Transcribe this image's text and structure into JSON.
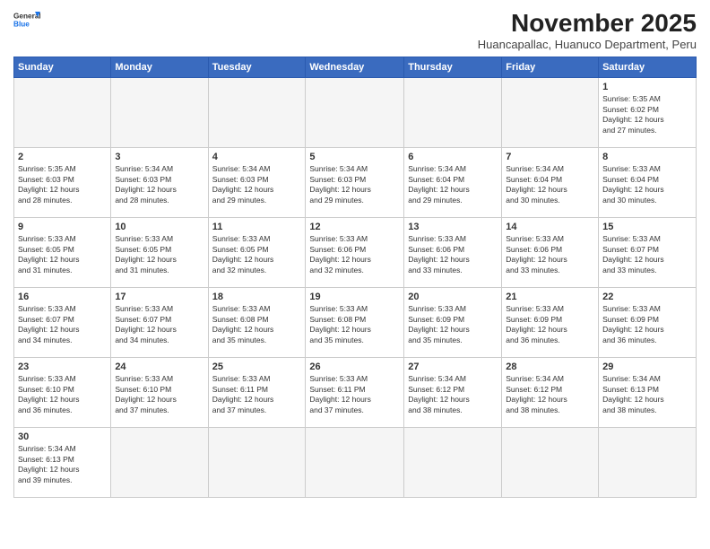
{
  "logo": {
    "text_general": "General",
    "text_blue": "Blue"
  },
  "header": {
    "month": "November 2025",
    "location": "Huancapallac, Huanuco Department, Peru"
  },
  "weekdays": [
    "Sunday",
    "Monday",
    "Tuesday",
    "Wednesday",
    "Thursday",
    "Friday",
    "Saturday"
  ],
  "weeks": [
    [
      {
        "day": "",
        "info": ""
      },
      {
        "day": "",
        "info": ""
      },
      {
        "day": "",
        "info": ""
      },
      {
        "day": "",
        "info": ""
      },
      {
        "day": "",
        "info": ""
      },
      {
        "day": "",
        "info": ""
      },
      {
        "day": "1",
        "info": "Sunrise: 5:35 AM\nSunset: 6:02 PM\nDaylight: 12 hours\nand 27 minutes."
      }
    ],
    [
      {
        "day": "2",
        "info": "Sunrise: 5:35 AM\nSunset: 6:03 PM\nDaylight: 12 hours\nand 28 minutes."
      },
      {
        "day": "3",
        "info": "Sunrise: 5:34 AM\nSunset: 6:03 PM\nDaylight: 12 hours\nand 28 minutes."
      },
      {
        "day": "4",
        "info": "Sunrise: 5:34 AM\nSunset: 6:03 PM\nDaylight: 12 hours\nand 29 minutes."
      },
      {
        "day": "5",
        "info": "Sunrise: 5:34 AM\nSunset: 6:03 PM\nDaylight: 12 hours\nand 29 minutes."
      },
      {
        "day": "6",
        "info": "Sunrise: 5:34 AM\nSunset: 6:04 PM\nDaylight: 12 hours\nand 29 minutes."
      },
      {
        "day": "7",
        "info": "Sunrise: 5:34 AM\nSunset: 6:04 PM\nDaylight: 12 hours\nand 30 minutes."
      },
      {
        "day": "8",
        "info": "Sunrise: 5:33 AM\nSunset: 6:04 PM\nDaylight: 12 hours\nand 30 minutes."
      }
    ],
    [
      {
        "day": "9",
        "info": "Sunrise: 5:33 AM\nSunset: 6:05 PM\nDaylight: 12 hours\nand 31 minutes."
      },
      {
        "day": "10",
        "info": "Sunrise: 5:33 AM\nSunset: 6:05 PM\nDaylight: 12 hours\nand 31 minutes."
      },
      {
        "day": "11",
        "info": "Sunrise: 5:33 AM\nSunset: 6:05 PM\nDaylight: 12 hours\nand 32 minutes."
      },
      {
        "day": "12",
        "info": "Sunrise: 5:33 AM\nSunset: 6:06 PM\nDaylight: 12 hours\nand 32 minutes."
      },
      {
        "day": "13",
        "info": "Sunrise: 5:33 AM\nSunset: 6:06 PM\nDaylight: 12 hours\nand 33 minutes."
      },
      {
        "day": "14",
        "info": "Sunrise: 5:33 AM\nSunset: 6:06 PM\nDaylight: 12 hours\nand 33 minutes."
      },
      {
        "day": "15",
        "info": "Sunrise: 5:33 AM\nSunset: 6:07 PM\nDaylight: 12 hours\nand 33 minutes."
      }
    ],
    [
      {
        "day": "16",
        "info": "Sunrise: 5:33 AM\nSunset: 6:07 PM\nDaylight: 12 hours\nand 34 minutes."
      },
      {
        "day": "17",
        "info": "Sunrise: 5:33 AM\nSunset: 6:07 PM\nDaylight: 12 hours\nand 34 minutes."
      },
      {
        "day": "18",
        "info": "Sunrise: 5:33 AM\nSunset: 6:08 PM\nDaylight: 12 hours\nand 35 minutes."
      },
      {
        "day": "19",
        "info": "Sunrise: 5:33 AM\nSunset: 6:08 PM\nDaylight: 12 hours\nand 35 minutes."
      },
      {
        "day": "20",
        "info": "Sunrise: 5:33 AM\nSunset: 6:09 PM\nDaylight: 12 hours\nand 35 minutes."
      },
      {
        "day": "21",
        "info": "Sunrise: 5:33 AM\nSunset: 6:09 PM\nDaylight: 12 hours\nand 36 minutes."
      },
      {
        "day": "22",
        "info": "Sunrise: 5:33 AM\nSunset: 6:09 PM\nDaylight: 12 hours\nand 36 minutes."
      }
    ],
    [
      {
        "day": "23",
        "info": "Sunrise: 5:33 AM\nSunset: 6:10 PM\nDaylight: 12 hours\nand 36 minutes."
      },
      {
        "day": "24",
        "info": "Sunrise: 5:33 AM\nSunset: 6:10 PM\nDaylight: 12 hours\nand 37 minutes."
      },
      {
        "day": "25",
        "info": "Sunrise: 5:33 AM\nSunset: 6:11 PM\nDaylight: 12 hours\nand 37 minutes."
      },
      {
        "day": "26",
        "info": "Sunrise: 5:33 AM\nSunset: 6:11 PM\nDaylight: 12 hours\nand 37 minutes."
      },
      {
        "day": "27",
        "info": "Sunrise: 5:34 AM\nSunset: 6:12 PM\nDaylight: 12 hours\nand 38 minutes."
      },
      {
        "day": "28",
        "info": "Sunrise: 5:34 AM\nSunset: 6:12 PM\nDaylight: 12 hours\nand 38 minutes."
      },
      {
        "day": "29",
        "info": "Sunrise: 5:34 AM\nSunset: 6:13 PM\nDaylight: 12 hours\nand 38 minutes."
      }
    ],
    [
      {
        "day": "30",
        "info": "Sunrise: 5:34 AM\nSunset: 6:13 PM\nDaylight: 12 hours\nand 39 minutes."
      },
      {
        "day": "",
        "info": ""
      },
      {
        "day": "",
        "info": ""
      },
      {
        "day": "",
        "info": ""
      },
      {
        "day": "",
        "info": ""
      },
      {
        "day": "",
        "info": ""
      },
      {
        "day": "",
        "info": ""
      }
    ]
  ]
}
